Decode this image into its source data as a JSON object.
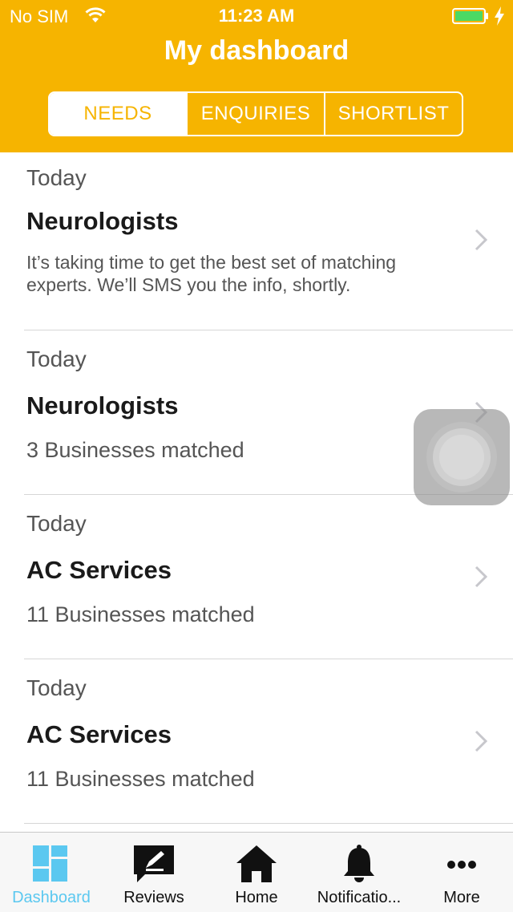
{
  "status_bar": {
    "carrier": "No SIM",
    "time": "11:23 AM"
  },
  "header": {
    "title": "My dashboard",
    "background_color": "#F6B400",
    "tabs": [
      {
        "label": "NEEDS",
        "selected": true
      },
      {
        "label": "ENQUIRIES",
        "selected": false
      },
      {
        "label": "SHORTLIST",
        "selected": false
      }
    ]
  },
  "items": [
    {
      "date": "Today",
      "title": "Neurologists",
      "description": "It’s taking time to get the best set of matching experts. We’ll SMS you the info, shortly."
    },
    {
      "date": "Today",
      "title": "Neurologists",
      "description": "3 Businesses matched"
    },
    {
      "date": "Today",
      "title": "AC Services",
      "description": "11 Businesses matched"
    },
    {
      "date": "Today",
      "title": "AC Services",
      "description": "11 Businesses matched"
    }
  ],
  "tab_bar": {
    "active_color": "#5BC8F0",
    "tabs": [
      {
        "label": "Dashboard",
        "icon": "dashboard-icon",
        "active": true
      },
      {
        "label": "Reviews",
        "icon": "reviews-icon",
        "active": false
      },
      {
        "label": "Home",
        "icon": "home-icon",
        "active": false
      },
      {
        "label": "Notificatio...",
        "icon": "bell-icon",
        "active": false
      },
      {
        "label": "More",
        "icon": "more-icon",
        "active": false
      }
    ]
  }
}
